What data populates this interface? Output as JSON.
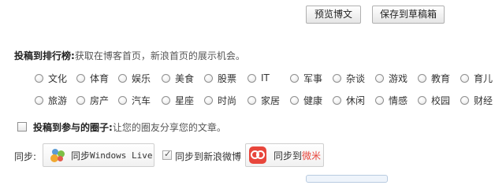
{
  "toolbar": {
    "preview_label": "预览博文",
    "save_draft_label": "保存到草稿箱"
  },
  "ranking": {
    "title": "投稿到排行榜:",
    "description": "获取在博客首页，新浪首页的展示机会。",
    "row1": [
      "文化",
      "体育",
      "娱乐",
      "美食",
      "股票",
      "IT",
      "军事",
      "杂谈",
      "游戏",
      "教育",
      "育儿"
    ],
    "row2": [
      "旅游",
      "房产",
      "汽车",
      "星座",
      "时尚",
      "家居",
      "健康",
      "休闲",
      "情感",
      "校园",
      "财经"
    ]
  },
  "circle": {
    "title": "投稿到参与的圈子:",
    "description": "让您的圈友分享您的文章。"
  },
  "sync": {
    "label": "同步:",
    "windows_live_prefix": "同步",
    "windows_live_name": "Windows Live",
    "sina_weibo_label": "同步到新浪微博",
    "weimi_prefix": "同步到",
    "weimi_name": "微米"
  }
}
